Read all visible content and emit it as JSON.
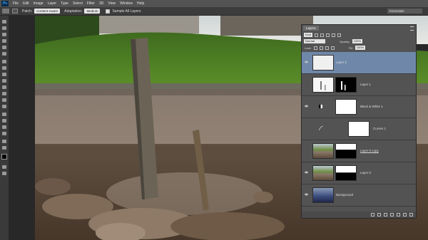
{
  "menubar": {
    "items": [
      "File",
      "Edit",
      "Image",
      "Layer",
      "Type",
      "Select",
      "Filter",
      "3D",
      "View",
      "Window",
      "Help"
    ]
  },
  "options_bar": {
    "patch_label": "Patch:",
    "patch_value": "Content-Aware",
    "adaptation_label": "Adaptation:",
    "adaptation_value": "Medium",
    "sample_all_label": "Sample All Layers",
    "workspace_value": "Essentials"
  },
  "layers_panel": {
    "tab_label": "Layers",
    "kind_value": "Kind",
    "blend_mode": "Normal",
    "opacity_label": "Opacity:",
    "opacity_value": "100%",
    "lock_label": "Lock:",
    "fill_label": "Fill:",
    "fill_value": "100%",
    "layers": [
      {
        "name": "Layer 2",
        "selected": true
      },
      {
        "name": "Layer 1",
        "selected": false
      },
      {
        "name": "Black & White 1",
        "selected": false
      },
      {
        "name": "Curves 1",
        "selected": false
      },
      {
        "name": "Layer 0 copy",
        "selected": false
      },
      {
        "name": "Layer 0",
        "selected": false
      },
      {
        "name": "Background",
        "selected": false
      }
    ]
  },
  "colors": {
    "selected_layer": "#6f88aa",
    "panel_bg": "#535353",
    "menubar_bg": "#535353"
  }
}
